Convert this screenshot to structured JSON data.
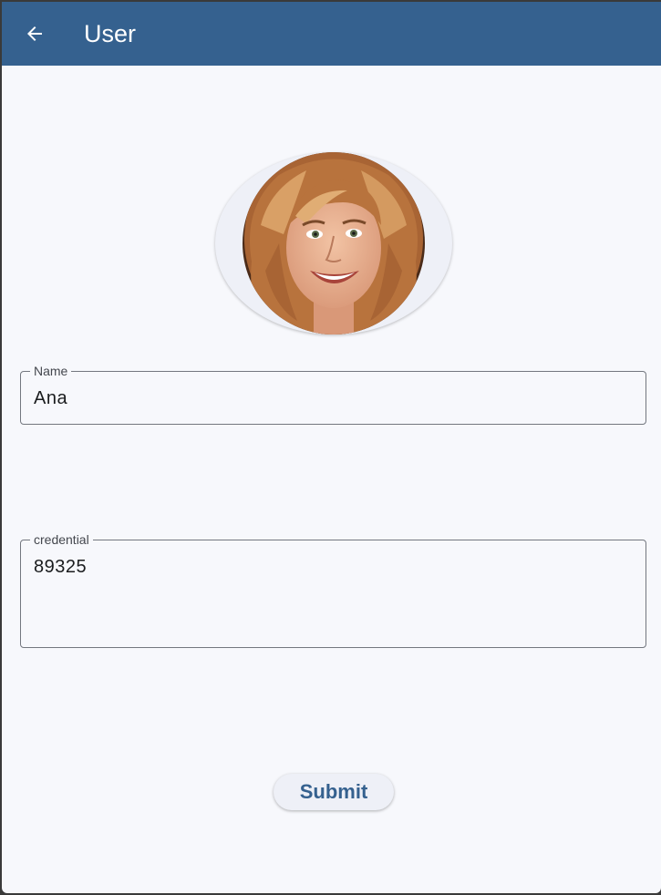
{
  "appbar": {
    "title": "User",
    "back_icon": "arrow-left-icon",
    "color": "#35618f"
  },
  "avatar": {
    "description_icon": "profile-photo"
  },
  "form": {
    "name": {
      "label": "Name",
      "value": "Ana"
    },
    "credential": {
      "label": "credential",
      "value": "89325"
    }
  },
  "actions": {
    "submit_label": "Submit"
  },
  "colors": {
    "background": "#f7f8fc",
    "accent": "#35618f",
    "outline": "#73777f"
  }
}
